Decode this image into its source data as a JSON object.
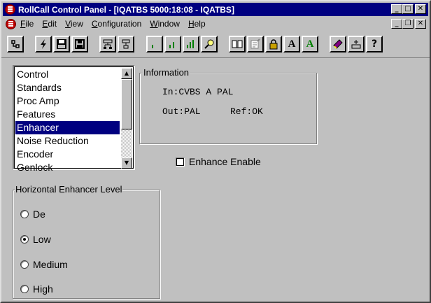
{
  "window": {
    "title": "RollCall Control Panel - [IQATBS 5000:18:08 - IQATBS]",
    "controls": {
      "minimize": "_",
      "maximize": "□",
      "close": "✕"
    }
  },
  "menu": {
    "items": [
      "File",
      "Edit",
      "View",
      "Configuration",
      "Window",
      "Help"
    ],
    "mdi_controls": {
      "minimize": "_",
      "restore": "❐",
      "close": "✕"
    }
  },
  "toolbar": {
    "text_a_label": "A",
    "green_a_label": "A",
    "help_label": "?"
  },
  "sidebar": {
    "items": [
      {
        "label": "Control"
      },
      {
        "label": "Standards"
      },
      {
        "label": "Proc Amp"
      },
      {
        "label": "Features"
      },
      {
        "label": "Enhancer",
        "selected": true
      },
      {
        "label": "Noise Reduction"
      },
      {
        "label": "Encoder"
      },
      {
        "label": "Genlock"
      }
    ]
  },
  "information": {
    "title": "Information",
    "input_line": "In:CVBS A PAL",
    "output_line": "Out:PAL",
    "ref_line": "Ref:OK"
  },
  "enhance_enable": {
    "label": "Enhance Enable",
    "checked": false
  },
  "enhancer_level": {
    "title": "Horizontal Enhancer Level",
    "options": [
      {
        "label": "De",
        "selected": false
      },
      {
        "label": "Low",
        "selected": true
      },
      {
        "label": "Medium",
        "selected": false
      },
      {
        "label": "High",
        "selected": false
      }
    ]
  },
  "colors": {
    "titlebar": "#000080",
    "selection": "#000080",
    "face": "#c0c0c0"
  }
}
